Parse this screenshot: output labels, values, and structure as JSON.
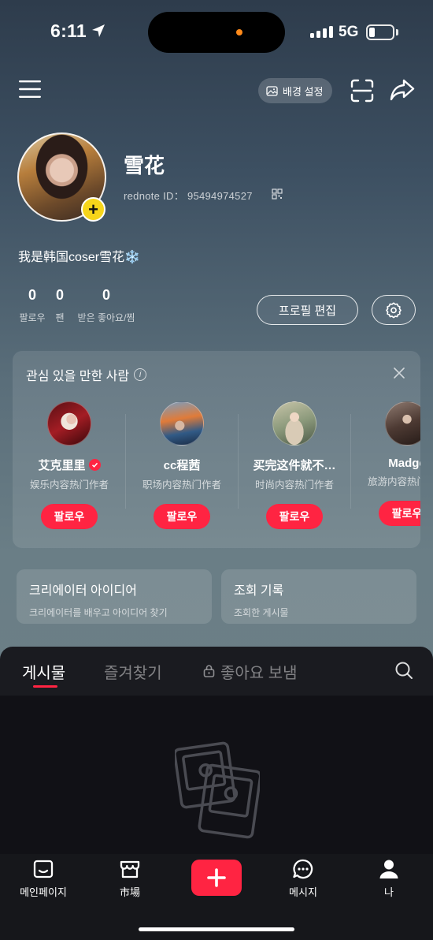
{
  "status_bar": {
    "time": "6:11",
    "network": "5G"
  },
  "header": {
    "background_button_label": "배경 설정"
  },
  "profile": {
    "name": "雪花",
    "id_label": "rednote ID：",
    "id_value": "95494974527",
    "bio": "我是韩国coser雪花❄️",
    "stats": [
      {
        "value": "0",
        "label": "팔로우"
      },
      {
        "value": "0",
        "label": "팬"
      },
      {
        "value": "0",
        "label": "받은 좋아요/찜"
      }
    ],
    "edit_label": "프로필 편집"
  },
  "suggestions": {
    "title": "관심 있을 만한 사람",
    "people": [
      {
        "name": "艾克里里",
        "desc": "娱乐内容热门作者",
        "follow": "팔로우",
        "verified": true
      },
      {
        "name": "cc程茜",
        "desc": "职场内容热门作者",
        "follow": "팔로우",
        "verified": false
      },
      {
        "name": "买完这件就不…",
        "desc": "时尚内容热门作者",
        "follow": "팔로우",
        "verified": false
      },
      {
        "name": "Madge",
        "desc": "旅游内容热门作者",
        "follow": "팔로우",
        "verified": false
      }
    ]
  },
  "cards": [
    {
      "title": "크리에이터 아이디어",
      "subtitle": "크리에이터를 배우고 아이디어 찾기"
    },
    {
      "title": "조회 기록",
      "subtitle": "조회한 게시물"
    }
  ],
  "tabs": [
    {
      "label": "게시물",
      "active": true
    },
    {
      "label": "즐겨찾기",
      "active": false
    },
    {
      "label": "좋아요 보냄",
      "active": false,
      "locked": true
    }
  ],
  "nav": [
    {
      "label": "메인페이지",
      "icon": "home-icon"
    },
    {
      "label": "市場",
      "icon": "store-icon"
    },
    {
      "label": "메시지",
      "icon": "message-icon"
    },
    {
      "label": "나",
      "icon": "user-icon"
    }
  ],
  "colors": {
    "accent": "#ff2442",
    "plus_badge": "#f7d51a"
  }
}
